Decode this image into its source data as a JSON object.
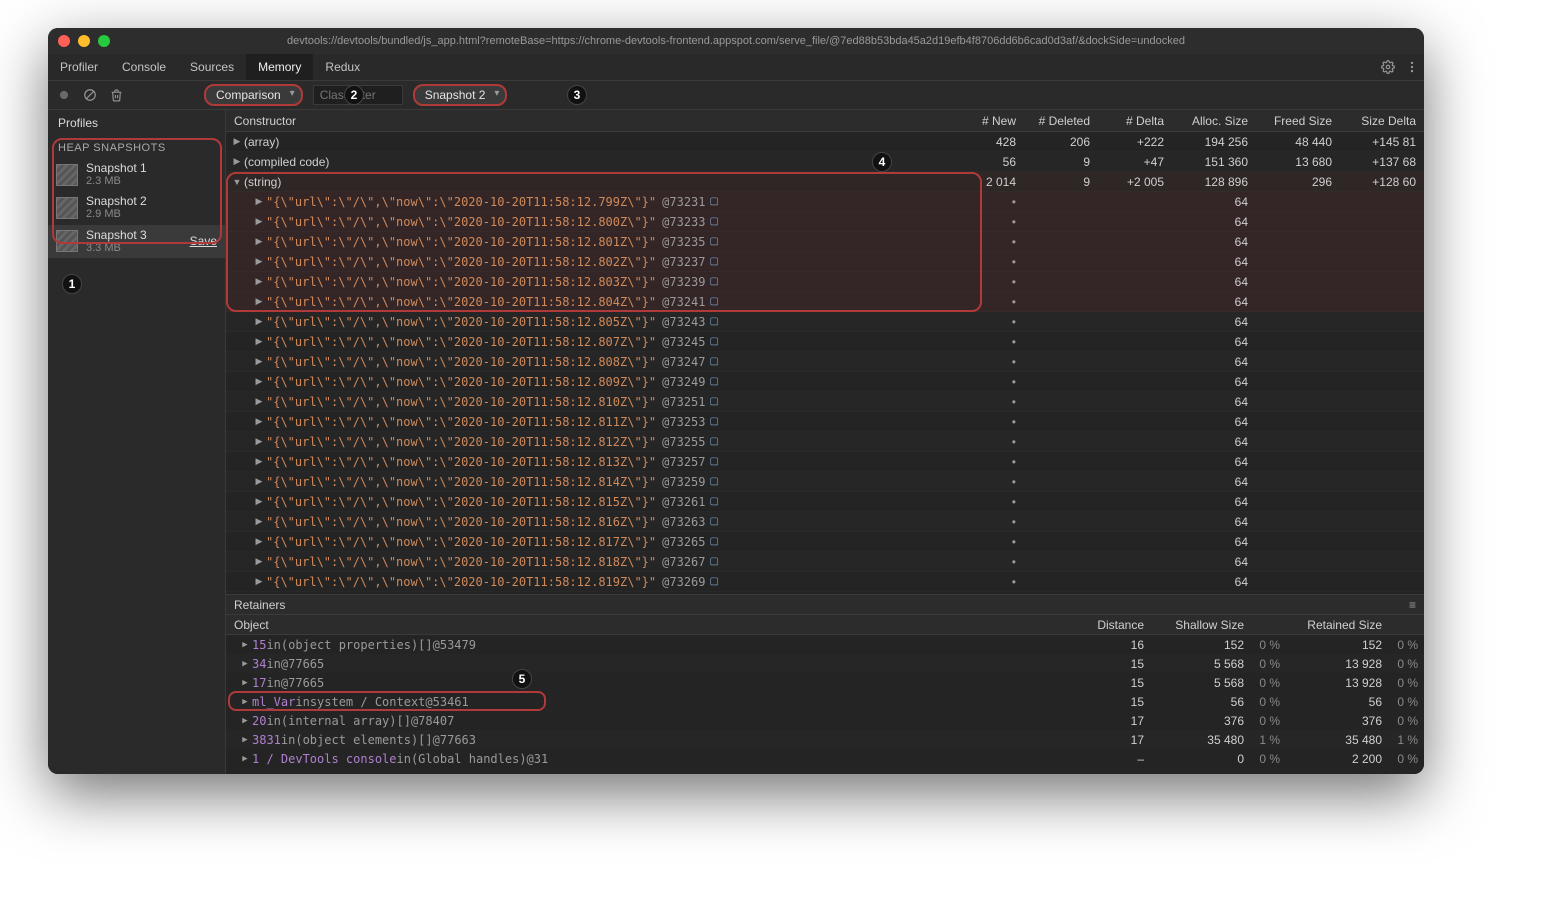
{
  "window": {
    "title": "devtools://devtools/bundled/js_app.html?remoteBase=https://chrome-devtools-frontend.appspot.com/serve_file/@7ed88b53bda45a2d19efb4f8706dd6b6cad0d3af/&dockSide=undocked"
  },
  "tabs": {
    "items": [
      "Profiler",
      "Console",
      "Sources",
      "Memory",
      "Redux"
    ],
    "active": "Memory"
  },
  "toolbar": {
    "view_select": "Comparison",
    "filter_placeholder": "Class filter",
    "baseline_select": "Snapshot 2"
  },
  "sidebar": {
    "title": "Profiles",
    "group": "HEAP SNAPSHOTS",
    "snapshots": [
      {
        "name": "Snapshot 1",
        "size": "2.3 MB",
        "selected": false,
        "save": false
      },
      {
        "name": "Snapshot 2",
        "size": "2.9 MB",
        "selected": false,
        "save": false
      },
      {
        "name": "Snapshot 3",
        "size": "3.3 MB",
        "selected": true,
        "save": true
      }
    ],
    "save_label": "Save"
  },
  "callouts": {
    "c1": "1",
    "c2": "2",
    "c3": "3",
    "c4": "4",
    "c5": "5"
  },
  "grid": {
    "headers": {
      "constructor": "Constructor",
      "new": "# New",
      "deleted": "# Deleted",
      "delta": "# Delta",
      "alloc": "Alloc. Size",
      "freed": "Freed Size",
      "sizedelta": "Size Delta"
    },
    "rows": [
      {
        "name": "(array)",
        "new": "428",
        "deleted": "206",
        "delta": "+222",
        "alloc": "194 256",
        "freed": "48 440",
        "sizedelta": "+145 81"
      },
      {
        "name": "(compiled code)",
        "new": "56",
        "deleted": "9",
        "delta": "+47",
        "alloc": "151 360",
        "freed": "13 680",
        "sizedelta": "+137 68"
      },
      {
        "name": "(string)",
        "new": "2 014",
        "deleted": "9",
        "delta": "+2 005",
        "alloc": "128 896",
        "freed": "296",
        "sizedelta": "+128 60",
        "expanded": true
      }
    ],
    "string_children_hl": [
      {
        "json": "\"{\\\"url\\\":\\\"/\\\",\\\"now\\\":\\\"2020-10-20T11:58:12.799Z\\\"}\"",
        "ref": "@73231",
        "alloc": "64"
      },
      {
        "json": "\"{\\\"url\\\":\\\"/\\\",\\\"now\\\":\\\"2020-10-20T11:58:12.800Z\\\"}\"",
        "ref": "@73233",
        "alloc": "64"
      },
      {
        "json": "\"{\\\"url\\\":\\\"/\\\",\\\"now\\\":\\\"2020-10-20T11:58:12.801Z\\\"}\"",
        "ref": "@73235",
        "alloc": "64"
      },
      {
        "json": "\"{\\\"url\\\":\\\"/\\\",\\\"now\\\":\\\"2020-10-20T11:58:12.802Z\\\"}\"",
        "ref": "@73237",
        "alloc": "64"
      },
      {
        "json": "\"{\\\"url\\\":\\\"/\\\",\\\"now\\\":\\\"2020-10-20T11:58:12.803Z\\\"}\"",
        "ref": "@73239",
        "alloc": "64"
      },
      {
        "json": "\"{\\\"url\\\":\\\"/\\\",\\\"now\\\":\\\"2020-10-20T11:58:12.804Z\\\"}\"",
        "ref": "@73241",
        "alloc": "64"
      }
    ],
    "string_children_rest": [
      {
        "json": "\"{\\\"url\\\":\\\"/\\\",\\\"now\\\":\\\"2020-10-20T11:58:12.805Z\\\"}\"",
        "ref": "@73243",
        "alloc": "64"
      },
      {
        "json": "\"{\\\"url\\\":\\\"/\\\",\\\"now\\\":\\\"2020-10-20T11:58:12.807Z\\\"}\"",
        "ref": "@73245",
        "alloc": "64"
      },
      {
        "json": "\"{\\\"url\\\":\\\"/\\\",\\\"now\\\":\\\"2020-10-20T11:58:12.808Z\\\"}\"",
        "ref": "@73247",
        "alloc": "64"
      },
      {
        "json": "\"{\\\"url\\\":\\\"/\\\",\\\"now\\\":\\\"2020-10-20T11:58:12.809Z\\\"}\"",
        "ref": "@73249",
        "alloc": "64"
      },
      {
        "json": "\"{\\\"url\\\":\\\"/\\\",\\\"now\\\":\\\"2020-10-20T11:58:12.810Z\\\"}\"",
        "ref": "@73251",
        "alloc": "64"
      },
      {
        "json": "\"{\\\"url\\\":\\\"/\\\",\\\"now\\\":\\\"2020-10-20T11:58:12.811Z\\\"}\"",
        "ref": "@73253",
        "alloc": "64"
      },
      {
        "json": "\"{\\\"url\\\":\\\"/\\\",\\\"now\\\":\\\"2020-10-20T11:58:12.812Z\\\"}\"",
        "ref": "@73255",
        "alloc": "64"
      },
      {
        "json": "\"{\\\"url\\\":\\\"/\\\",\\\"now\\\":\\\"2020-10-20T11:58:12.813Z\\\"}\"",
        "ref": "@73257",
        "alloc": "64"
      },
      {
        "json": "\"{\\\"url\\\":\\\"/\\\",\\\"now\\\":\\\"2020-10-20T11:58:12.814Z\\\"}\"",
        "ref": "@73259",
        "alloc": "64"
      },
      {
        "json": "\"{\\\"url\\\":\\\"/\\\",\\\"now\\\":\\\"2020-10-20T11:58:12.815Z\\\"}\"",
        "ref": "@73261",
        "alloc": "64"
      },
      {
        "json": "\"{\\\"url\\\":\\\"/\\\",\\\"now\\\":\\\"2020-10-20T11:58:12.816Z\\\"}\"",
        "ref": "@73263",
        "alloc": "64"
      },
      {
        "json": "\"{\\\"url\\\":\\\"/\\\",\\\"now\\\":\\\"2020-10-20T11:58:12.817Z\\\"}\"",
        "ref": "@73265",
        "alloc": "64"
      },
      {
        "json": "\"{\\\"url\\\":\\\"/\\\",\\\"now\\\":\\\"2020-10-20T11:58:12.818Z\\\"}\"",
        "ref": "@73267",
        "alloc": "64"
      },
      {
        "json": "\"{\\\"url\\\":\\\"/\\\",\\\"now\\\":\\\"2020-10-20T11:58:12.819Z\\\"}\"",
        "ref": "@73269",
        "alloc": "64"
      }
    ]
  },
  "retainers": {
    "title": "Retainers",
    "headers": {
      "object": "Object",
      "distance": "Distance",
      "shallow": "Shallow Size",
      "retained": "Retained Size"
    },
    "rows": [
      {
        "label_pre": "15",
        "label_mid": " in ",
        "label_type": "(object properties)[]",
        "ref": " @53479",
        "dist": "16",
        "shallow": "152",
        "shpct": "0 %",
        "retained": "152",
        "rtpct": "0 %"
      },
      {
        "label_pre": "34",
        "label_mid": " in ",
        "label_type": "",
        "ref": " @77665",
        "dist": "15",
        "shallow": "5 568",
        "shpct": "0 %",
        "retained": "13 928",
        "rtpct": "0 %"
      },
      {
        "label_pre": "17",
        "label_mid": " in ",
        "label_type": "",
        "ref": " @77665",
        "dist": "15",
        "shallow": "5 568",
        "shpct": "0 %",
        "retained": "13 928",
        "rtpct": "0 %"
      },
      {
        "label_pre": "ml_Var",
        "label_mid": " in ",
        "label_type": "system / Context",
        "ref": " @53461",
        "dist": "15",
        "shallow": "56",
        "shpct": "0 %",
        "retained": "56",
        "rtpct": "0 %",
        "highlight": true
      },
      {
        "label_pre": "20",
        "label_mid": " in ",
        "label_type": "(internal array)[]",
        "ref": " @78407",
        "dist": "17",
        "shallow": "376",
        "shpct": "0 %",
        "retained": "376",
        "rtpct": "0 %"
      },
      {
        "label_pre": "3831",
        "label_mid": " in ",
        "label_type": "(object elements)[]",
        "ref": " @77663",
        "dist": "17",
        "shallow": "35 480",
        "shpct": "1 %",
        "retained": "35 480",
        "rtpct": "1 %"
      },
      {
        "label_pre": "1 / DevTools console",
        "label_mid": " in ",
        "label_type": "(Global handles)",
        "ref": " @31",
        "dist": "–",
        "shallow": "0",
        "shpct": "0 %",
        "retained": "2 200",
        "rtpct": "0 %"
      }
    ]
  }
}
